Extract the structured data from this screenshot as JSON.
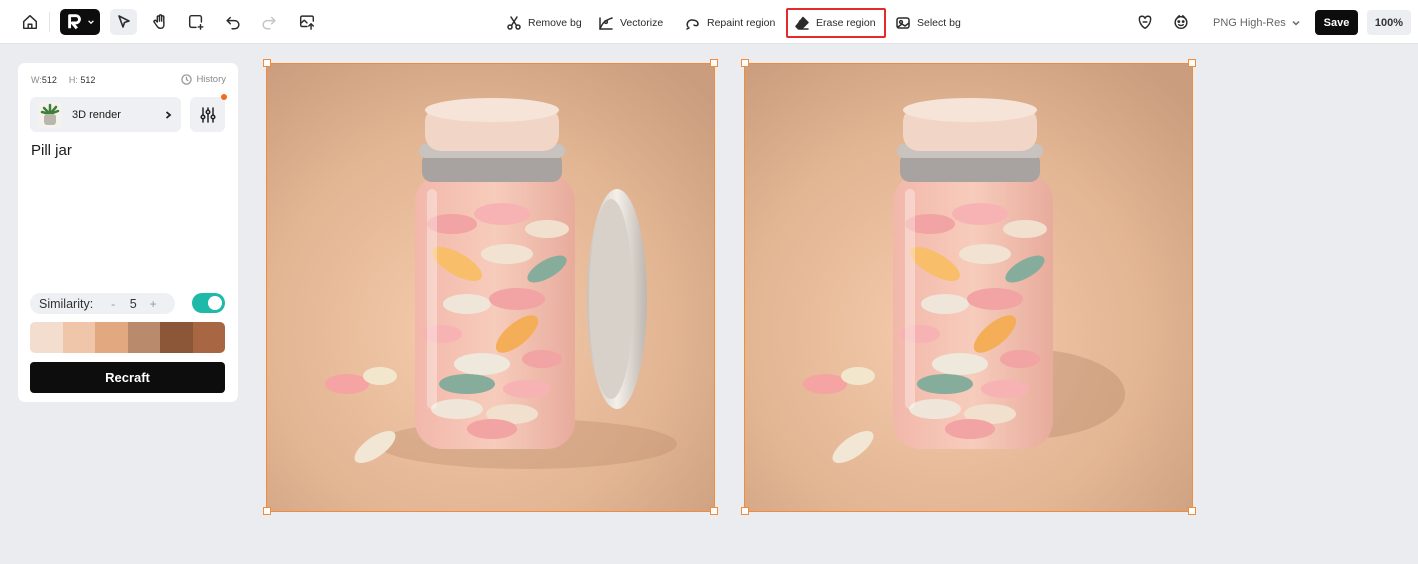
{
  "toolbar": {
    "home_icon": "home-icon",
    "undo_icon": "undo-icon",
    "redo_icon": "redo-icon",
    "actions": [
      {
        "label": "Remove bg",
        "icon": "remove-bg-icon"
      },
      {
        "label": "Vectorize",
        "icon": "vectorize-icon"
      },
      {
        "label": "Repaint region",
        "icon": "repaint-icon"
      },
      {
        "label": "Erase region",
        "icon": "eraser-icon",
        "highlighted": true
      },
      {
        "label": "Select bg",
        "icon": "select-bg-icon"
      }
    ],
    "export_format": "PNG High-Res",
    "save_label": "Save",
    "zoom": "100%"
  },
  "panel": {
    "width_label": "W:",
    "width_value": "512",
    "height_label": "H:",
    "height_value": "512",
    "history_label": "History",
    "style_name": "3D render",
    "prompt": "Pill jar",
    "similarity_label": "Similarity:",
    "similarity_minus": "-",
    "similarity_value": "5",
    "similarity_plus": "+",
    "palette": [
      "#f2ddcf",
      "#efc6a9",
      "#e2a981",
      "#b98a6b",
      "#8c5638",
      "#a86643"
    ],
    "recraft_label": "Recraft"
  },
  "colors": {
    "accent": "#f28c3a",
    "toggle_on": "#1fb9a9",
    "highlight": "#e32b2b"
  }
}
